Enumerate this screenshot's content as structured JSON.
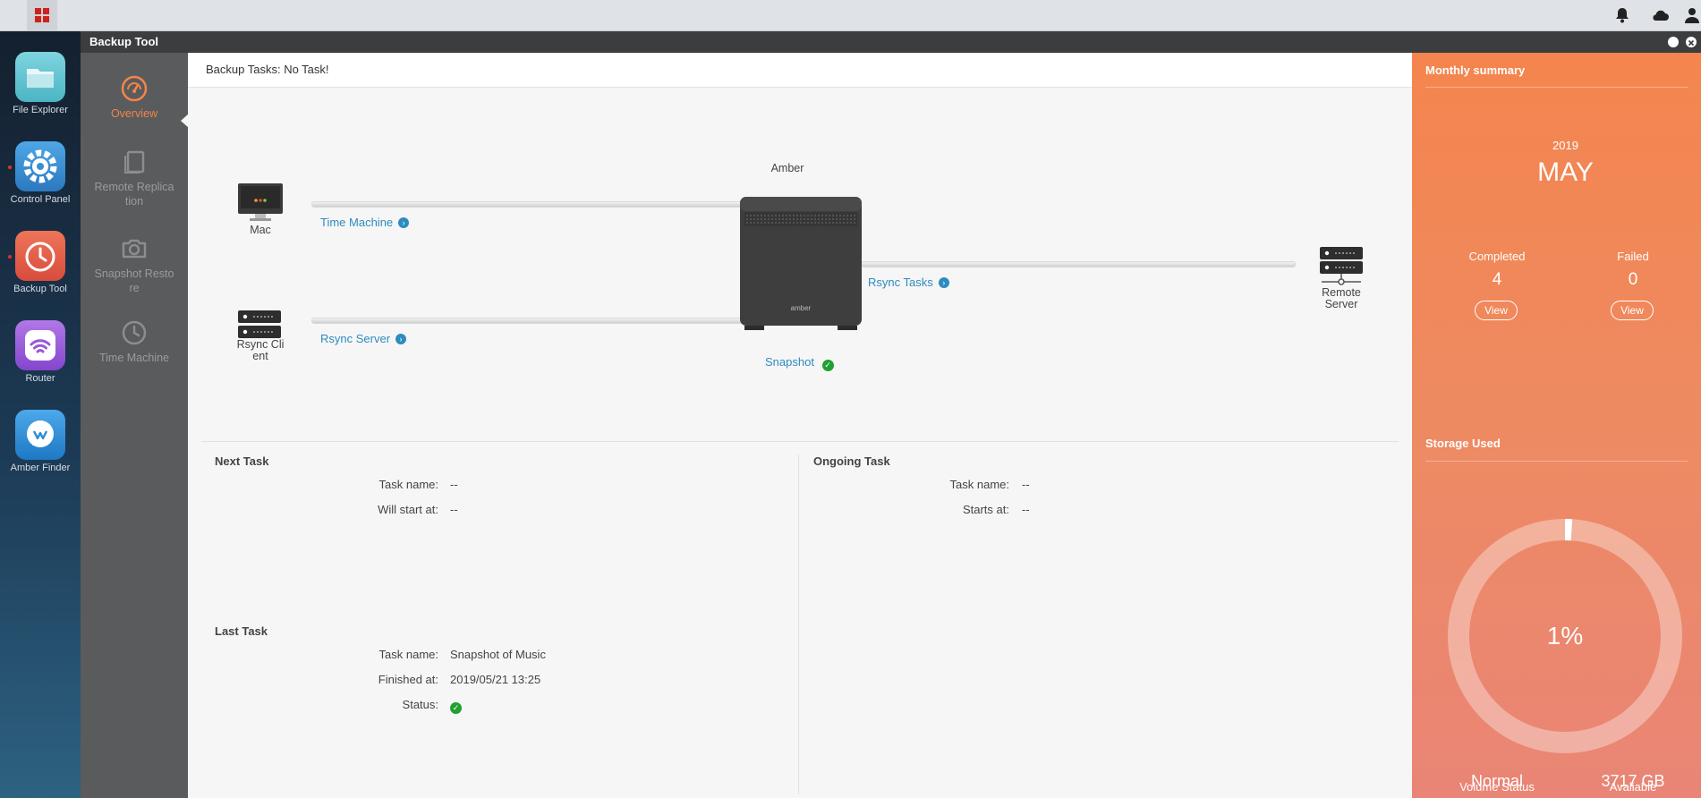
{
  "taskbar": {
    "start_icon": "grid-icon",
    "tray_icons": [
      "bell-icon",
      "cloud-icon",
      "user-icon"
    ]
  },
  "desktop": {
    "icons": [
      {
        "label": "File Explorer",
        "icon": "folder-icon",
        "color": "#5fc2cf"
      },
      {
        "label": "Control Panel",
        "icon": "gear-icon",
        "color": "#3a8fd1"
      },
      {
        "label": "Backup Tool",
        "icon": "clock-icon",
        "color": "#e0614c"
      },
      {
        "label": "Router",
        "icon": "wifi-icon",
        "color": "#9a58d8"
      },
      {
        "label": "Amber Finder",
        "icon": "chat-search-icon",
        "color": "#2f8fd6"
      }
    ]
  },
  "window": {
    "title": "Backup Tool"
  },
  "sidebar": {
    "items": [
      {
        "label": "Overview",
        "icon": "speedometer-icon",
        "active": true
      },
      {
        "label": "Remote Replication",
        "icon": "document-icon",
        "active": false
      },
      {
        "label": "Snapshot Restore",
        "icon": "camera-icon",
        "active": false
      },
      {
        "label": "Time Machine",
        "icon": "clock-icon",
        "active": false
      }
    ],
    "label_lines": [
      [
        "Remote Replica",
        "tion"
      ],
      [
        "Snapshot Resto",
        "re"
      ]
    ]
  },
  "header": {
    "text": "Backup Tasks: No Task!"
  },
  "diagram": {
    "center_label": "Amber",
    "device_brand": "amber",
    "mac_label": "Mac",
    "rsync_client_label": [
      "Rsync Cli",
      "ent"
    ],
    "remote_server_label": [
      "Remote",
      "Server"
    ],
    "links": {
      "time_machine": "Time Machine",
      "rsync_server": "Rsync Server",
      "rsync_tasks": "Rsync Tasks",
      "snapshot": "Snapshot"
    }
  },
  "next_task": {
    "title": "Next Task",
    "task_name_label": "Task name:",
    "task_name": "--",
    "start_label": "Will start at:",
    "start": "--"
  },
  "ongoing_task": {
    "title": "Ongoing Task",
    "task_name_label": "Task name:",
    "task_name": "--",
    "start_label": "Starts at:",
    "start": "--"
  },
  "last_task": {
    "title": "Last Task",
    "task_name_label": "Task name:",
    "task_name": "Snapshot of Music",
    "finished_label": "Finished at:",
    "finished": "2019/05/21 13:25",
    "status_label": "Status:",
    "status_icon": "check-circle-icon"
  },
  "monthly_summary": {
    "title": "Monthly summary",
    "year": "2019",
    "month": "MAY",
    "completed_label": "Completed",
    "completed": "4",
    "failed_label": "Failed",
    "failed": "0",
    "view_label": "View"
  },
  "storage": {
    "title": "Storage Used",
    "percent_text": "1%",
    "percent_value": 0.01,
    "volume_status_label": "Volume Status",
    "volume_status": "Normal",
    "available_label": "Avaliable",
    "available": "3717 GB"
  },
  "colors": {
    "accent": "#f2844c",
    "link": "#2e8bc0",
    "ok": "#22a031"
  }
}
